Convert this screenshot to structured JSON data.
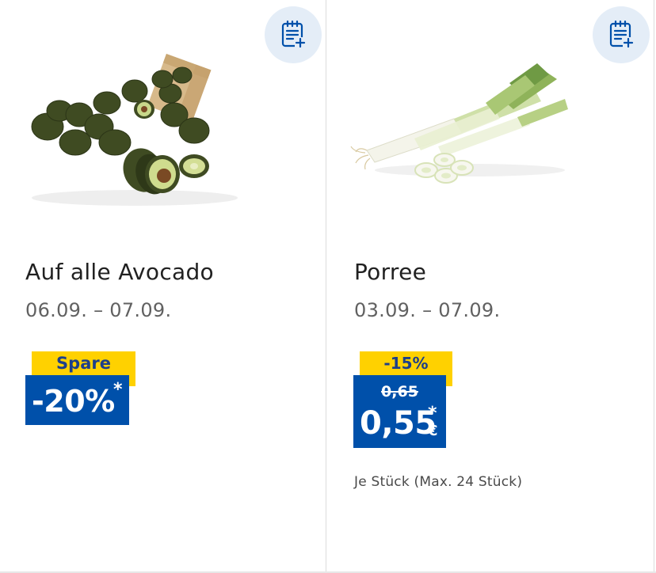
{
  "products": [
    {
      "name": "Auf alle Avocado",
      "dates": "06.09. – 07.09.",
      "badge_label": "Spare",
      "discount": "-20%",
      "star": "*",
      "add_to_list_icon": "list-add-icon",
      "image": "avocados"
    },
    {
      "name": "Porree",
      "dates": "03.09. – 07.09.",
      "badge_label": "-15%",
      "old_price": "0,65",
      "price": "0,55",
      "currency": "€",
      "star": "*",
      "unit_info": "Je Stück (Max. 24 Stück)",
      "add_to_list_icon": "list-add-icon",
      "image": "leeks"
    }
  ],
  "colors": {
    "badge_blue": "#0050aa",
    "badge_yellow": "#ffd100",
    "button_bg": "#e4edf7",
    "icon_blue": "#0050aa"
  }
}
